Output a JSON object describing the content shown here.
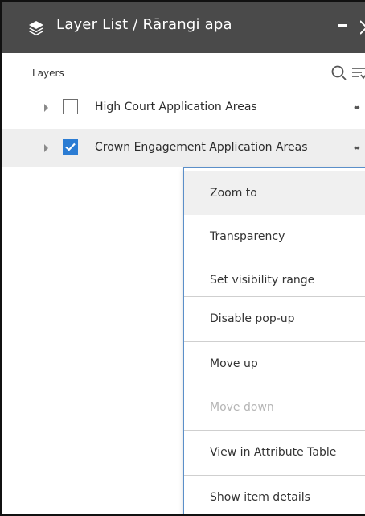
{
  "window": {
    "title": "Layer List / Rārangi apa",
    "minimize_label": "–"
  },
  "panel": {
    "header": "Layers"
  },
  "layers": [
    {
      "label": "High Court Application Areas",
      "checked": false,
      "more": "••"
    },
    {
      "label": "Crown Engagement Application Areas",
      "checked": true,
      "more": "••"
    }
  ],
  "context_menu": {
    "items": [
      {
        "label": "Zoom to",
        "state": "hover"
      },
      {
        "label": "Transparency",
        "state": "normal"
      },
      {
        "label": "Set visibility range",
        "state": "normal"
      },
      {
        "label": "Disable pop-up",
        "state": "normal"
      },
      {
        "label": "Move up",
        "state": "normal"
      },
      {
        "label": "Move down",
        "state": "disabled"
      },
      {
        "label": "View in Attribute Table",
        "state": "normal"
      },
      {
        "label": "Show item details",
        "state": "normal"
      }
    ]
  },
  "colors": {
    "titlebar": "#4a4a4a",
    "checkbox_checked": "#2b7cd3",
    "menu_border": "#5b8fc9",
    "selected_row": "#eeeeee",
    "disabled_text": "#b5b5b5"
  },
  "icons": {
    "title": "layers-icon",
    "search": "search-icon",
    "filter": "filter-icon",
    "expand": "expand-caret-icon",
    "more": "more-options-icon",
    "check": "checkmark-icon"
  }
}
